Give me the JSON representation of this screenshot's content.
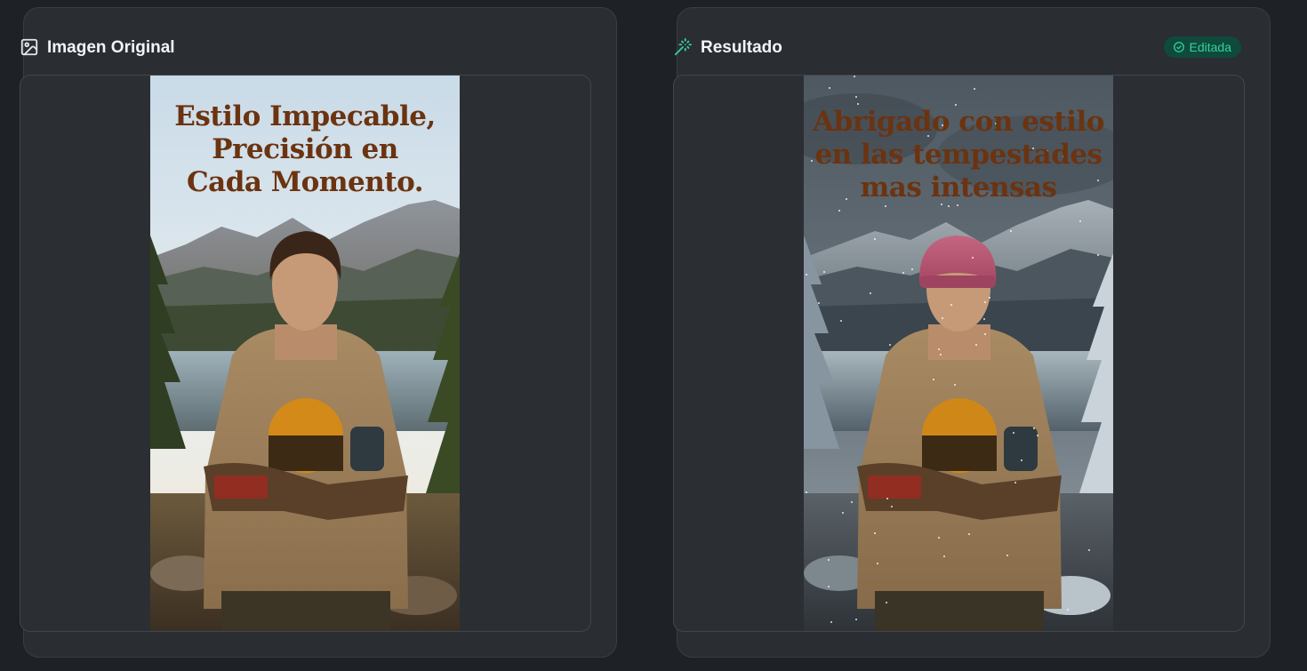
{
  "original": {
    "icon": "image-icon",
    "title": "Imagen Original",
    "headline": [
      "Estilo Impecable,",
      "Precisión en",
      "Cada Momento."
    ]
  },
  "result": {
    "icon": "magic-wand-icon",
    "title": "Resultado",
    "badge": {
      "icon": "check-circle-icon",
      "label": "Editada"
    },
    "headline": [
      "Abrigado con estilo",
      "en las tempestades",
      "mas intensas"
    ]
  },
  "colors": {
    "background": "#1e2125",
    "panel": "#2a2d32",
    "badge_bg": "#0f4a3c",
    "badge_text": "#34d399",
    "headline": "#6b3310"
  }
}
